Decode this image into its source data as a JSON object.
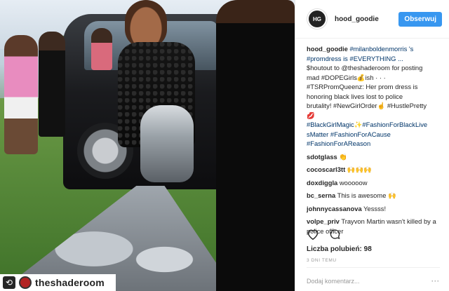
{
  "photo": {
    "repost_username": "theshaderoom"
  },
  "header": {
    "avatar_text": "HG",
    "username": "hood_goodie",
    "follow_label": "Obserwuj"
  },
  "caption": {
    "author": "hood_goodie",
    "lines": [
      {
        "text": "#milanboldenmorris 's",
        "link": true
      },
      {
        "text": "#promdress is #EVERYTHING ...",
        "link": true
      },
      {
        "text": "$houtout to @theshaderoom for posting",
        "link": false
      },
      {
        "text": "mad #DOPEGirls💰ish · · ·",
        "link": false
      },
      {
        "text": "#TSRPromQueenz: Her prom dress is",
        "link": false
      },
      {
        "text": "honoring black lives lost to police",
        "link": false
      },
      {
        "text": "brutality! #NewGirlOrder☝ #HustlePretty",
        "link": false
      },
      {
        "text": "💋",
        "link": false
      },
      {
        "text": "#BlackGirlMagic✨#FashionForBlackLive",
        "link": true
      },
      {
        "text": "sMatter #FashionForACause",
        "link": true
      },
      {
        "text": "#FashionForAReason",
        "link": true
      }
    ]
  },
  "comments": [
    {
      "user": "sdotglass",
      "text": "👏"
    },
    {
      "user": "cocoscarl3tt",
      "text": "🙌🙌🙌"
    },
    {
      "user": "doxdiggla",
      "text": "wooooow"
    },
    {
      "user": "bc_serna",
      "text": "This is awesome 🙌"
    },
    {
      "user": "johnnycassanova",
      "text": "Yessss!"
    },
    {
      "user": "volpe_priv",
      "text": "Trayvon Martin wasn't killed by a police officer"
    }
  ],
  "actions": {
    "like_icon": "heart-icon",
    "comment_icon": "comment-icon"
  },
  "likes": {
    "label": "Liczba polubień: 98"
  },
  "time": "3 DNI TEMU",
  "add_comment": {
    "placeholder": "Dodaj komentarz...",
    "more": "···"
  }
}
